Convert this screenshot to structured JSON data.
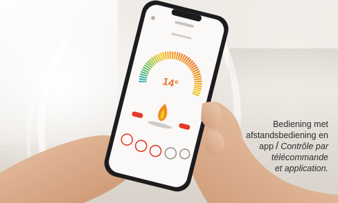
{
  "caption": {
    "nl_line1": "Bediening met",
    "nl_line2": "afstandsbediening en",
    "nl_line3": "app",
    "separator": "/",
    "fr_line1": "Contrôle par",
    "fr_line2": "télécommande",
    "fr_line3": "et application."
  },
  "phone_screen": {
    "temperature": "14°"
  },
  "colors": {
    "accent_red": "#e53a2a",
    "accent_orange": "#f08a24",
    "accent_yellow": "#f2c81e",
    "accent_green": "#7cc24b",
    "accent_teal": "#37b0b8"
  }
}
